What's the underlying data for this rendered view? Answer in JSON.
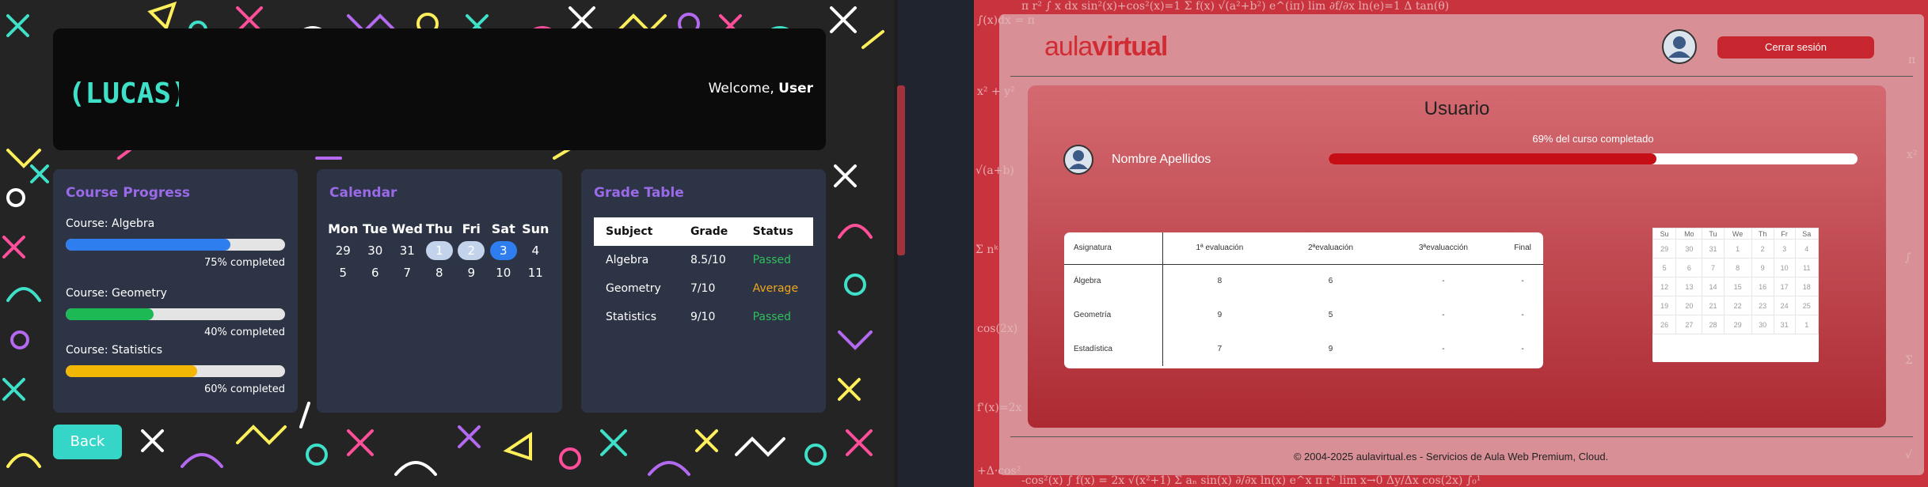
{
  "left_app": {
    "header": {
      "welcome_prefix": "Welcome, ",
      "welcome_user": "User"
    },
    "logo_text": "(LUCAS)²",
    "progress_card": {
      "title": "Course Progress",
      "courses": [
        {
          "label": "Course: Algebra",
          "percent": 75,
          "caption": "75% completed",
          "color": "#2f7ef0"
        },
        {
          "label": "Course: Geometry",
          "percent": 40,
          "caption": "40% completed",
          "color": "#1db954"
        },
        {
          "label": "Course: Statistics",
          "percent": 60,
          "caption": "60% completed",
          "color": "#f2b705"
        }
      ]
    },
    "calendar_card": {
      "title": "Calendar",
      "days": [
        "Mon",
        "Tue",
        "Wed",
        "Thu",
        "Fri",
        "Sat",
        "Sun"
      ],
      "week1": [
        "29",
        "30",
        "31",
        "1",
        "2",
        "3",
        "4"
      ],
      "week2": [
        "5",
        "6",
        "7",
        "8",
        "9",
        "10",
        "11"
      ]
    },
    "grade_card": {
      "title": "Grade Table",
      "headers": [
        "Subject",
        "Grade",
        "Status"
      ],
      "rows": [
        [
          "Algebra",
          "8.5/10",
          "Passed"
        ],
        [
          "Geometry",
          "7/10",
          "Average"
        ],
        [
          "Statistics",
          "9/10",
          "Passed"
        ]
      ]
    },
    "back_button": "Back"
  },
  "right_app": {
    "brand_a": "aula",
    "brand_b": "virtual",
    "logout_button": "Cerrar sesión",
    "page_title": "Usuario",
    "user_name": "Nombre Apellidos",
    "progress_label": "69% del curso completado",
    "progress_percent": 62,
    "table": {
      "headers": [
        "Asignatura",
        "1ª evaluación",
        "2ªevaluación",
        "3ªevaluacción",
        "Final"
      ],
      "rows": [
        [
          "Álgebra",
          "8",
          "6",
          "-",
          "-"
        ],
        [
          "Geometría",
          "9",
          "5",
          "-",
          "-"
        ],
        [
          "Estadística",
          "7",
          "9",
          "-",
          "-"
        ]
      ]
    },
    "mini_calendar": {
      "days": [
        "Su",
        "Mo",
        "Tu",
        "We",
        "Th",
        "Fr",
        "Sa"
      ],
      "weeks": [
        [
          "29",
          "30",
          "31",
          "1",
          "2",
          "3",
          "4"
        ],
        [
          "5",
          "6",
          "7",
          "8",
          "9",
          "10",
          "11"
        ],
        [
          "12",
          "13",
          "14",
          "15",
          "16",
          "17",
          "18"
        ],
        [
          "19",
          "20",
          "21",
          "22",
          "23",
          "24",
          "25"
        ],
        [
          "26",
          "27",
          "28",
          "29",
          "30",
          "31",
          "1"
        ]
      ]
    },
    "footer": "© 2004-2025 aulavirtual.es - Servicios de Aula Web Premium, Cloud."
  }
}
